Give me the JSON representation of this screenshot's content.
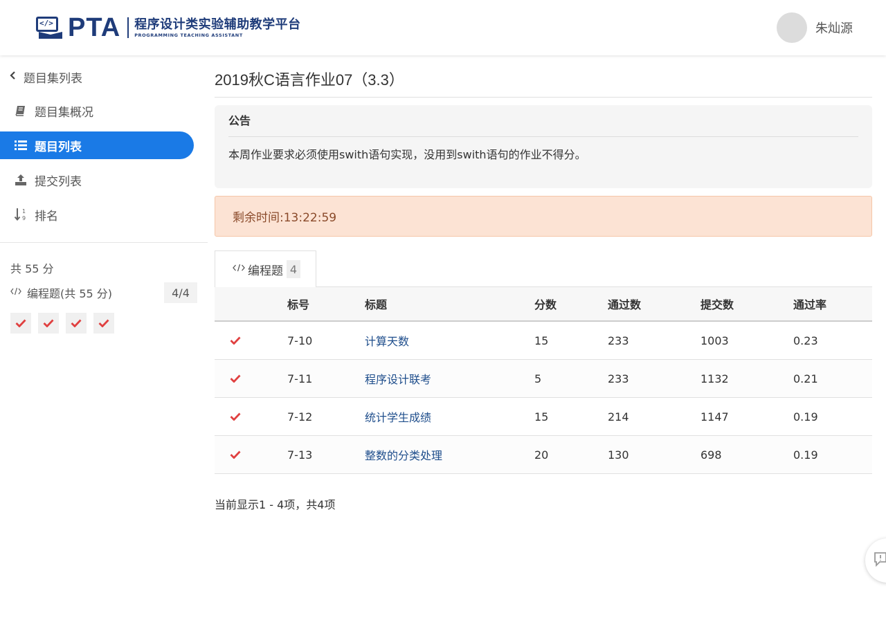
{
  "header": {
    "logo_mark": "</>",
    "logo_pta": "PTA",
    "logo_cn": "程序设计类实验辅助教学平台",
    "logo_en": "PROGRAMMING TEACHING ASSISTANT",
    "username": "朱灿源"
  },
  "sidebar": {
    "back_label": "题目集列表",
    "items": [
      {
        "label": "题目集概况",
        "icon": "book-icon"
      },
      {
        "label": "题目列表",
        "icon": "list-icon",
        "active": true
      },
      {
        "label": "提交列表",
        "icon": "upload-icon"
      },
      {
        "label": "排名",
        "icon": "sort-icon"
      }
    ],
    "total": "共 55 分",
    "category_label": "编程题(共 55 分)",
    "category_badge": "4/4",
    "problem_status": [
      "accepted",
      "accepted",
      "accepted",
      "accepted"
    ]
  },
  "main": {
    "title": "2019秋C语言作业07（3.3）",
    "notice": {
      "title": "公告",
      "body": "本周作业要求必须使用swith语句实现，没用到swith语句的作业不得分。"
    },
    "timer": "剩余时间:13:22:59",
    "tab": {
      "label": "编程题",
      "count": "4"
    },
    "table": {
      "headers": [
        "标号",
        "标题",
        "分数",
        "通过数",
        "提交数",
        "通过率"
      ],
      "rows": [
        {
          "id": "7-10",
          "title": "计算天数",
          "score": "15",
          "passed": "233",
          "submitted": "1003",
          "rate": "0.23"
        },
        {
          "id": "7-11",
          "title": "程序设计联考",
          "score": "5",
          "passed": "233",
          "submitted": "1132",
          "rate": "0.21"
        },
        {
          "id": "7-12",
          "title": "统计学生成绩",
          "score": "15",
          "passed": "214",
          "submitted": "1147",
          "rate": "0.19"
        },
        {
          "id": "7-13",
          "title": "整数的分类处理",
          "score": "20",
          "passed": "130",
          "submitted": "698",
          "rate": "0.19"
        }
      ]
    },
    "pager": "当前显示1 - 4项，共4项"
  },
  "colors": {
    "brand": "#1f3c7a",
    "active_nav": "#1a7ae6",
    "check": "#e04040",
    "timer_bg": "#fce3d4"
  }
}
